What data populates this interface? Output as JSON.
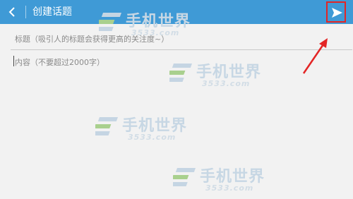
{
  "header": {
    "title": "创建话题",
    "accent": "#3f9ad6"
  },
  "form": {
    "title_placeholder": "标题（吸引人的标题会获得更高的关注度~）",
    "content_placeholder": "内容（不要超过2000字）"
  },
  "watermark": {
    "brand": "手机世界",
    "site": "3533.com"
  },
  "annotation": {
    "highlight_color": "#e32525"
  }
}
